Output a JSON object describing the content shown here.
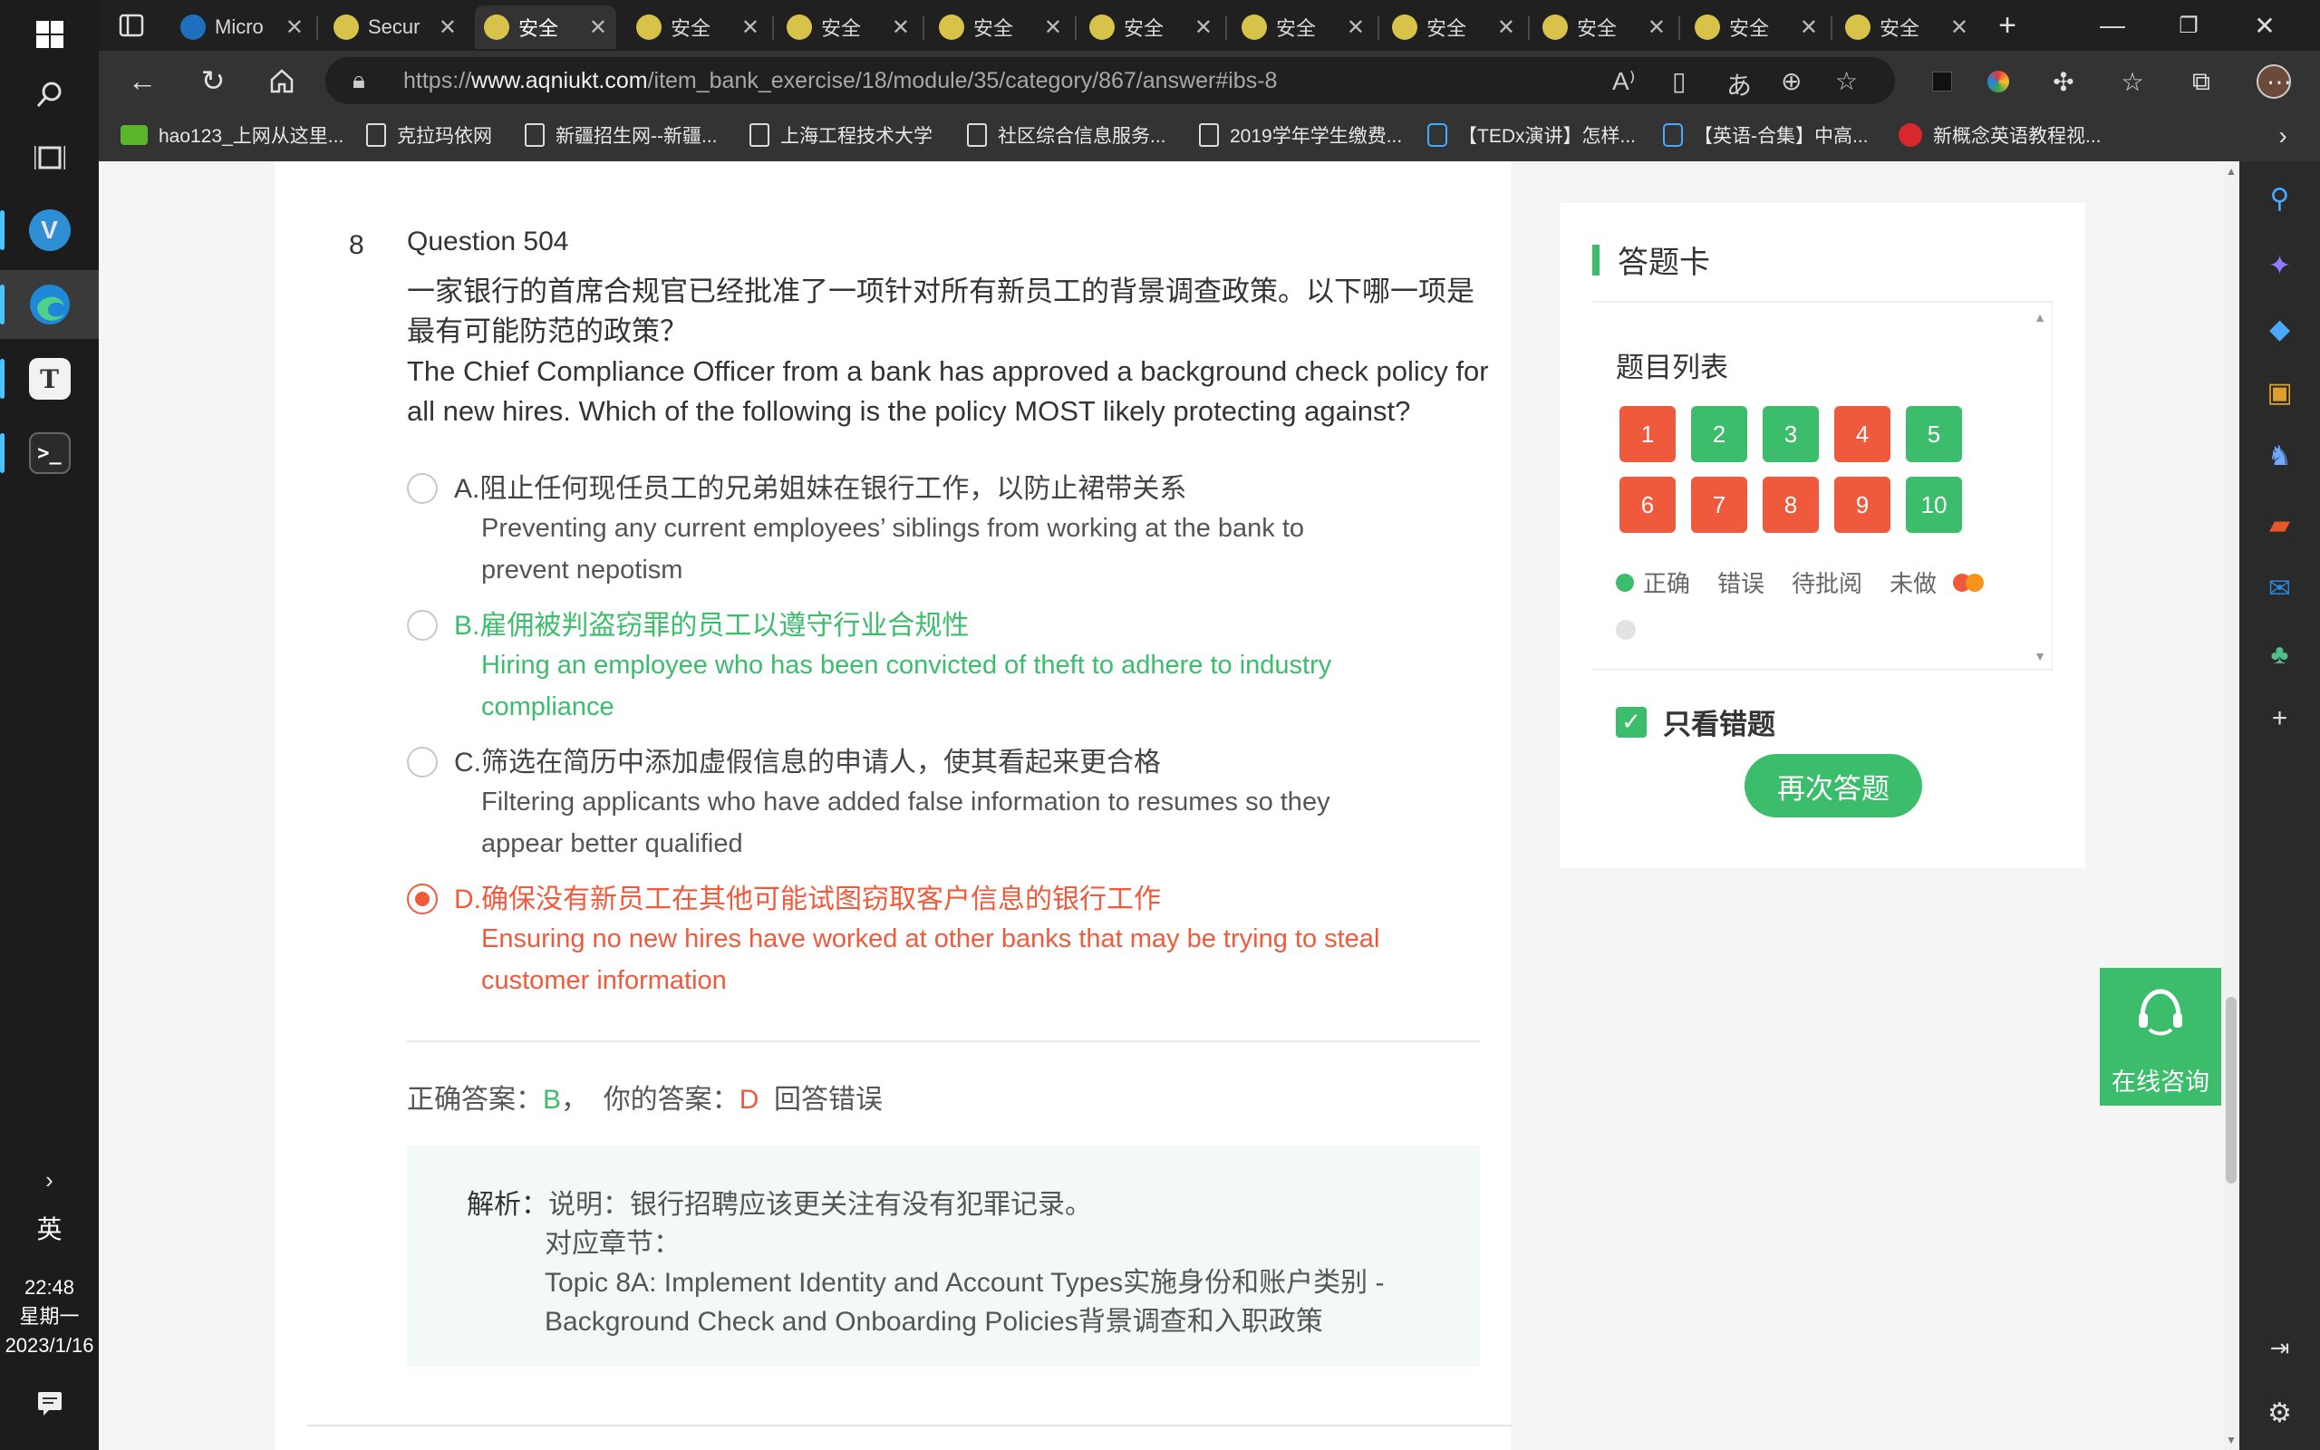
{
  "taskbar": {
    "lang": "英",
    "time": "22:48",
    "weekday": "星期一",
    "date": "2023/1/16"
  },
  "tabs": [
    {
      "title": "Micro",
      "icon_color": "#1f6fbf"
    },
    {
      "title": "Secur",
      "icon_color": "#d8c34a"
    },
    {
      "title": "安全",
      "icon_color": "#d8c34a",
      "active": true
    },
    {
      "title": "安全",
      "icon_color": "#d8c34a"
    },
    {
      "title": "安全",
      "icon_color": "#d8c34a"
    },
    {
      "title": "安全",
      "icon_color": "#d8c34a"
    },
    {
      "title": "安全",
      "icon_color": "#d8c34a"
    },
    {
      "title": "安全",
      "icon_color": "#d8c34a"
    },
    {
      "title": "安全",
      "icon_color": "#d8c34a"
    },
    {
      "title": "安全",
      "icon_color": "#d8c34a"
    },
    {
      "title": "安全",
      "icon_color": "#d8c34a"
    },
    {
      "title": "安全",
      "icon_color": "#d8c34a"
    }
  ],
  "address": {
    "prefix": "https://",
    "domain": "www.aqniukt.com",
    "path": "/item_bank_exercise/18/module/35/category/867/answer#ibs-8"
  },
  "bookmarks": [
    {
      "label": "hao123_上网从这里...",
      "icon": "green"
    },
    {
      "label": "克拉玛依网",
      "icon": "page"
    },
    {
      "label": "新疆招生网--新疆...",
      "icon": "page"
    },
    {
      "label": "上海工程技术大学",
      "icon": "page"
    },
    {
      "label": "社区综合信息服务...",
      "icon": "page"
    },
    {
      "label": "2019学年学生缴费...",
      "icon": "page"
    },
    {
      "label": "【TEDx演讲】怎样...",
      "icon": "tv"
    },
    {
      "label": "【英语-合集】中高...",
      "icon": "tv"
    },
    {
      "label": "新概念英语教程视...",
      "icon": "red"
    }
  ],
  "question": {
    "index": "8",
    "title": "Question 504",
    "text_cn_1": "一家银行的首席合规官已经批准了一项针对所有新员工的背景调查政策。以下哪一项是",
    "text_cn_2": "最有可能防范的政策？",
    "text_en_1": "The Chief Compliance Officer from a bank has approved a background check policy for",
    "text_en_2": "all new hires. Which of the following is the policy MOST likely protecting against?",
    "options": [
      {
        "cn": "A.阻止任何现任员工的兄弟姐妹在银行工作，以防止裙带关系",
        "en1": "Preventing any current employees’ siblings from working at the bank to",
        "en2": "prevent nepotism"
      },
      {
        "cn": "B.雇佣被判盗窃罪的员工以遵守行业合规性",
        "en1": "Hiring an employee who has been convicted of theft to adhere to industry",
        "en2": "compliance"
      },
      {
        "cn": "C.筛选在简历中添加虚假信息的申请人，使其看起来更合格",
        "en1": "Filtering applicants who have added false information to resumes so they",
        "en2": "appear better qualified"
      },
      {
        "cn": "D.确保没有新员工在其他可能试图窃取客户信息的银行工作",
        "en1": "Ensuring no new hires have worked at other banks that may be trying to steal",
        "en2": "customer information"
      }
    ]
  },
  "answer": {
    "correct_label": "正确答案：",
    "correct_value": "B",
    "sep": "，",
    "yours_label": "你的答案：",
    "yours_value": "D",
    "result": "回答错误"
  },
  "analysis": {
    "label": "解析：",
    "line1": "说明：银行招聘应该更关注有没有犯罪记录。",
    "line2": "对应章节：",
    "line3": "Topic 8A: Implement Identity and Account Types实施身份和账户类别 -",
    "line4": "Background Check and Onboarding Policies背景调查和入职政策"
  },
  "answer_card": {
    "title": "答题卡",
    "list_title": "题目列表",
    "items": [
      {
        "n": "1",
        "status": "wrong"
      },
      {
        "n": "2",
        "status": "correct"
      },
      {
        "n": "3",
        "status": "correct"
      },
      {
        "n": "4",
        "status": "wrong"
      },
      {
        "n": "5",
        "status": "correct"
      },
      {
        "n": "6",
        "status": "wrong"
      },
      {
        "n": "7",
        "status": "wrong"
      },
      {
        "n": "8",
        "status": "wrong"
      },
      {
        "n": "9",
        "status": "wrong"
      },
      {
        "n": "10",
        "status": "correct"
      }
    ],
    "legend_correct": "正确",
    "legend_wrong": "错误",
    "legend_pending": "待批阅",
    "legend_undone": "未做",
    "only_wrong_label": "只看错题",
    "only_wrong_checked": true,
    "retry_label": "再次答题"
  },
  "consult": {
    "label": "在线咨询"
  },
  "colors": {
    "correct": "#3cbd6b",
    "wrong": "#f05a3c",
    "accent_blue": "#4cc2ff"
  }
}
